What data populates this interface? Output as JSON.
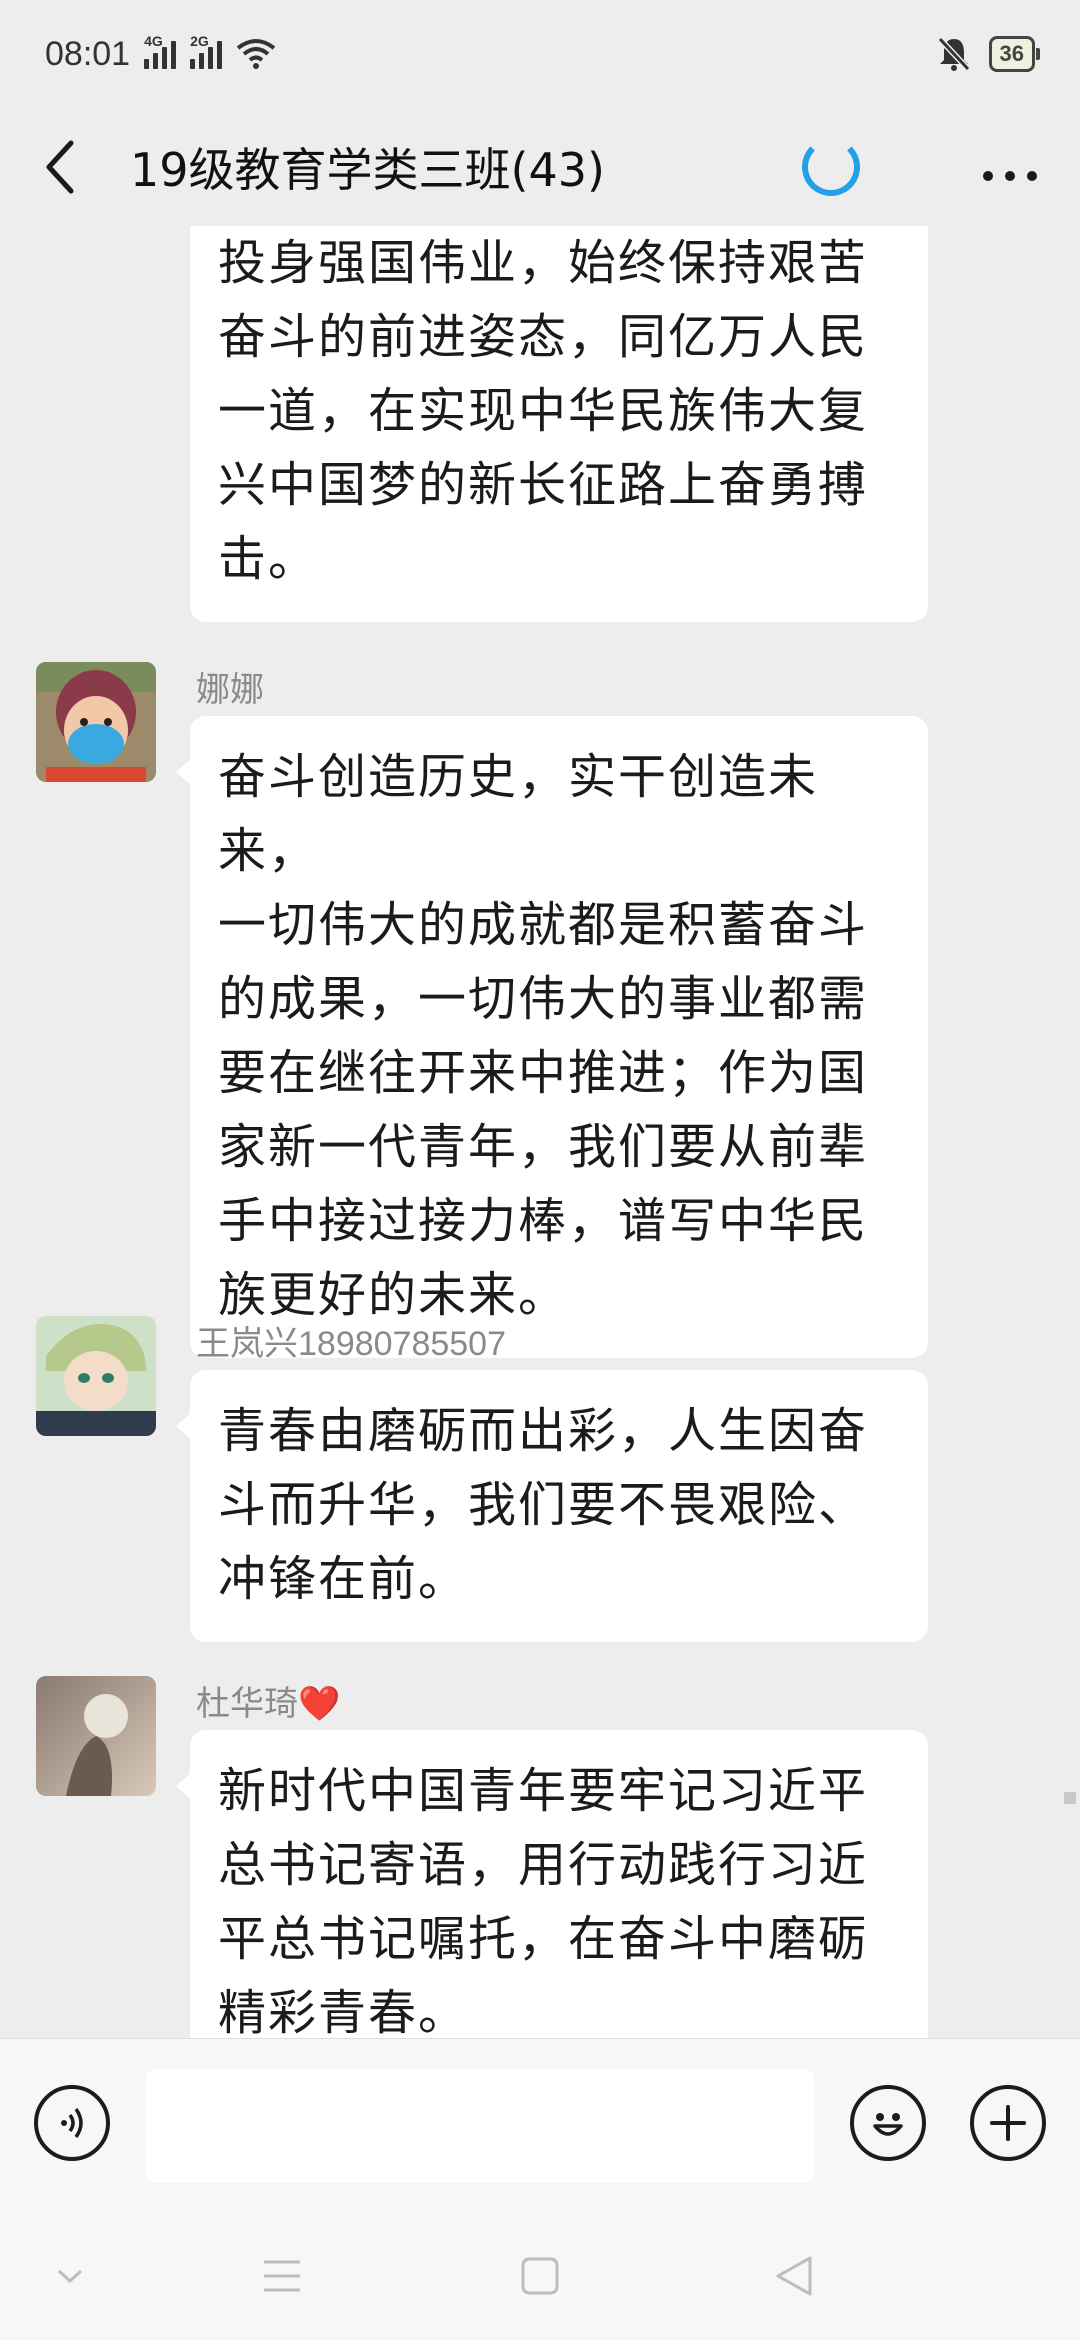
{
  "status_bar": {
    "time": "08:01",
    "network_1": "4G",
    "network_2": "2G",
    "battery": "36"
  },
  "header": {
    "title": "19级教育学类三班(43)"
  },
  "messages": [
    {
      "sender": "",
      "lines": [
        "投身强国伟业，始终保持艰苦",
        "奋斗的前进姿态，同亿万人民",
        "一道，在实现中华民族伟大复",
        "兴中国梦的新长征路上奋勇搏",
        "击。"
      ]
    },
    {
      "sender": "娜娜",
      "lines": [
        "奋斗创造历史，实干创造未来，",
        "一切伟大的成就都是积蓄奋斗",
        "的成果，一切伟大的事业都需",
        "要在继往开来中推进；作为国",
        "家新一代青年，我们要从前辈",
        "手中接过接力棒，谱写中华民",
        "族更好的未来。"
      ]
    },
    {
      "sender": "王岚兴18980785507",
      "lines": [
        "青春由磨砺而出彩，人生因奋",
        "斗而升华，我们要不畏艰险、",
        "冲锋在前。"
      ]
    },
    {
      "sender": "杜华琦❤️",
      "lines": [
        "新时代中国青年要牢记习近平",
        "总书记寄语，用行动践行习近",
        "平总书记嘱托，在奋斗中磨砺",
        "精彩青春。"
      ]
    }
  ],
  "input": {
    "value": ""
  },
  "icons": {
    "back": "back-arrow-icon",
    "loading": "loading-spinner-icon",
    "more": "more-options-icon",
    "voice": "voice-icon",
    "emoji": "emoji-icon",
    "plus": "plus-icon"
  }
}
